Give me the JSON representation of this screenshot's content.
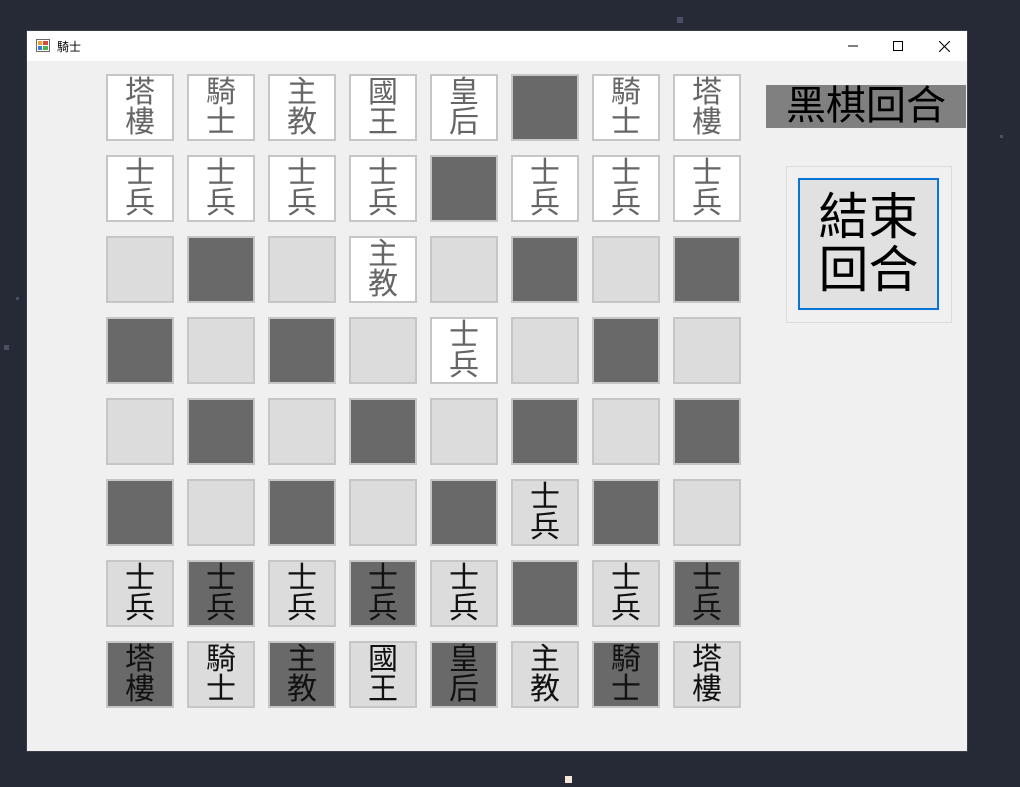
{
  "window": {
    "title": "騎士",
    "minimize_glyph": "–",
    "maximize_glyph": "☐",
    "close_glyph": "✕"
  },
  "game": {
    "turn_label": "黑棋回合",
    "end_turn_label": "結束回合"
  },
  "colors": {
    "white_square": "#ffffff",
    "light_square": "#dcdcdc",
    "dark_square": "#696969",
    "gray_text": "#666666",
    "black_text": "#111111",
    "focus_border": "#0a74d4"
  },
  "board": [
    [
      {
        "text": "塔樓",
        "bg": "white",
        "fg": "gray"
      },
      {
        "text": "騎士",
        "bg": "white",
        "fg": "gray"
      },
      {
        "text": "主教",
        "bg": "white",
        "fg": "gray"
      },
      {
        "text": "國王",
        "bg": "white",
        "fg": "gray"
      },
      {
        "text": "皇后",
        "bg": "white",
        "fg": "gray"
      },
      {
        "text": "",
        "bg": "dark",
        "fg": "gray"
      },
      {
        "text": "騎士",
        "bg": "white",
        "fg": "gray"
      },
      {
        "text": "塔樓",
        "bg": "white",
        "fg": "gray"
      }
    ],
    [
      {
        "text": "士兵",
        "bg": "white",
        "fg": "gray"
      },
      {
        "text": "士兵",
        "bg": "white",
        "fg": "gray"
      },
      {
        "text": "士兵",
        "bg": "white",
        "fg": "gray"
      },
      {
        "text": "士兵",
        "bg": "white",
        "fg": "gray"
      },
      {
        "text": "",
        "bg": "dark",
        "fg": "gray"
      },
      {
        "text": "士兵",
        "bg": "white",
        "fg": "gray"
      },
      {
        "text": "士兵",
        "bg": "white",
        "fg": "gray"
      },
      {
        "text": "士兵",
        "bg": "white",
        "fg": "gray"
      }
    ],
    [
      {
        "text": "",
        "bg": "light",
        "fg": "gray"
      },
      {
        "text": "",
        "bg": "dark",
        "fg": "gray"
      },
      {
        "text": "",
        "bg": "light",
        "fg": "gray"
      },
      {
        "text": "主教",
        "bg": "white",
        "fg": "gray"
      },
      {
        "text": "",
        "bg": "light",
        "fg": "gray"
      },
      {
        "text": "",
        "bg": "dark",
        "fg": "gray"
      },
      {
        "text": "",
        "bg": "light",
        "fg": "gray"
      },
      {
        "text": "",
        "bg": "dark",
        "fg": "gray"
      }
    ],
    [
      {
        "text": "",
        "bg": "dark",
        "fg": "gray"
      },
      {
        "text": "",
        "bg": "light",
        "fg": "gray"
      },
      {
        "text": "",
        "bg": "dark",
        "fg": "gray"
      },
      {
        "text": "",
        "bg": "light",
        "fg": "gray"
      },
      {
        "text": "士兵",
        "bg": "white",
        "fg": "gray"
      },
      {
        "text": "",
        "bg": "light",
        "fg": "gray"
      },
      {
        "text": "",
        "bg": "dark",
        "fg": "gray"
      },
      {
        "text": "",
        "bg": "light",
        "fg": "gray"
      }
    ],
    [
      {
        "text": "",
        "bg": "light",
        "fg": "gray"
      },
      {
        "text": "",
        "bg": "dark",
        "fg": "gray"
      },
      {
        "text": "",
        "bg": "light",
        "fg": "gray"
      },
      {
        "text": "",
        "bg": "dark",
        "fg": "gray"
      },
      {
        "text": "",
        "bg": "light",
        "fg": "gray"
      },
      {
        "text": "",
        "bg": "dark",
        "fg": "gray"
      },
      {
        "text": "",
        "bg": "light",
        "fg": "gray"
      },
      {
        "text": "",
        "bg": "dark",
        "fg": "gray"
      }
    ],
    [
      {
        "text": "",
        "bg": "dark",
        "fg": "gray"
      },
      {
        "text": "",
        "bg": "light",
        "fg": "gray"
      },
      {
        "text": "",
        "bg": "dark",
        "fg": "gray"
      },
      {
        "text": "",
        "bg": "light",
        "fg": "gray"
      },
      {
        "text": "",
        "bg": "dark",
        "fg": "gray"
      },
      {
        "text": "士兵",
        "bg": "light",
        "fg": "black"
      },
      {
        "text": "",
        "bg": "dark",
        "fg": "gray"
      },
      {
        "text": "",
        "bg": "light",
        "fg": "gray"
      }
    ],
    [
      {
        "text": "士兵",
        "bg": "light",
        "fg": "black"
      },
      {
        "text": "士兵",
        "bg": "dark",
        "fg": "black"
      },
      {
        "text": "士兵",
        "bg": "light",
        "fg": "black"
      },
      {
        "text": "士兵",
        "bg": "dark",
        "fg": "black"
      },
      {
        "text": "士兵",
        "bg": "light",
        "fg": "black"
      },
      {
        "text": "",
        "bg": "dark",
        "fg": "gray"
      },
      {
        "text": "士兵",
        "bg": "light",
        "fg": "black"
      },
      {
        "text": "士兵",
        "bg": "dark",
        "fg": "black"
      }
    ],
    [
      {
        "text": "塔樓",
        "bg": "dark",
        "fg": "black"
      },
      {
        "text": "騎士",
        "bg": "light",
        "fg": "black"
      },
      {
        "text": "主教",
        "bg": "dark",
        "fg": "black"
      },
      {
        "text": "國王",
        "bg": "light",
        "fg": "black"
      },
      {
        "text": "皇后",
        "bg": "dark",
        "fg": "black"
      },
      {
        "text": "主教",
        "bg": "light",
        "fg": "black"
      },
      {
        "text": "騎士",
        "bg": "dark",
        "fg": "black"
      },
      {
        "text": "塔樓",
        "bg": "light",
        "fg": "black"
      }
    ]
  ]
}
